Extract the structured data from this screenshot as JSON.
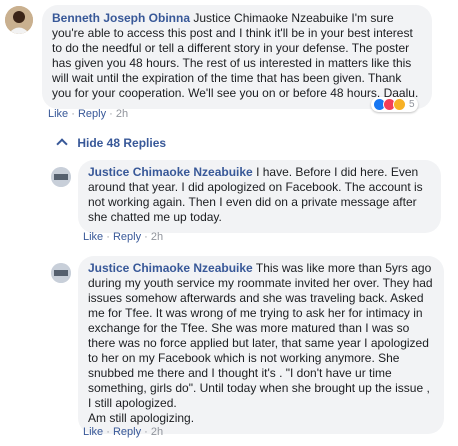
{
  "comment": {
    "author": "Benneth Joseph Obinna",
    "text": "Justice Chimaoke Nzeabuike I'm sure you're able to access this post and I think it'll be in your best interest to do the needful or tell a different story in your defense. The poster has given you 48 hours. The rest of us interested in matters like this will wait until the expiration of the time that has been given. Thank you for your cooperation. We'll see you on or before 48 hours. Daalu.",
    "like": "Like",
    "reply": "Reply",
    "sep": "·",
    "time": "2h",
    "reaction_count": "5",
    "reaction_icons": [
      "like-icon",
      "love-icon",
      "haha-icon"
    ]
  },
  "toggle": {
    "chevron": "^",
    "label": "Hide 48 Replies"
  },
  "replies": [
    {
      "author": "Justice Chimaoke Nzeabuike",
      "text": "I have. Before I did here. Even around that year. I did apologized on Facebook. The account is not working again. Then I even did on a private message after she chatted me up today.",
      "like": "Like",
      "reply": "Reply",
      "sep": "·",
      "time": "2h"
    },
    {
      "author": "Justice Chimaoke Nzeabuike",
      "text": "This was like more than 5yrs ago during my youth service my roommate invited her over. They had issues somehow afterwards and she was traveling back. Asked me for Tfee. It was wrong of me trying to ask her for intimacy in exchange for the Tfee. She was more matured than I was so there was no force applied but later, that same year I apologized to her on my Facebook which is not working anymore. She snubbed me there and I thought it's . \"I don't have ur time something, girls do\". Until today when she brought up the issue , I still apologized.",
      "extra": "Am still apologizing.",
      "like": "Like",
      "reply": "Reply",
      "sep": "·",
      "time": "2h"
    }
  ],
  "colors": {
    "link": "#385898",
    "meta": "#90949c",
    "bubble": "#f2f3f5",
    "like": "#1877f2",
    "love": "#f33e58",
    "haha": "#f7b125"
  }
}
